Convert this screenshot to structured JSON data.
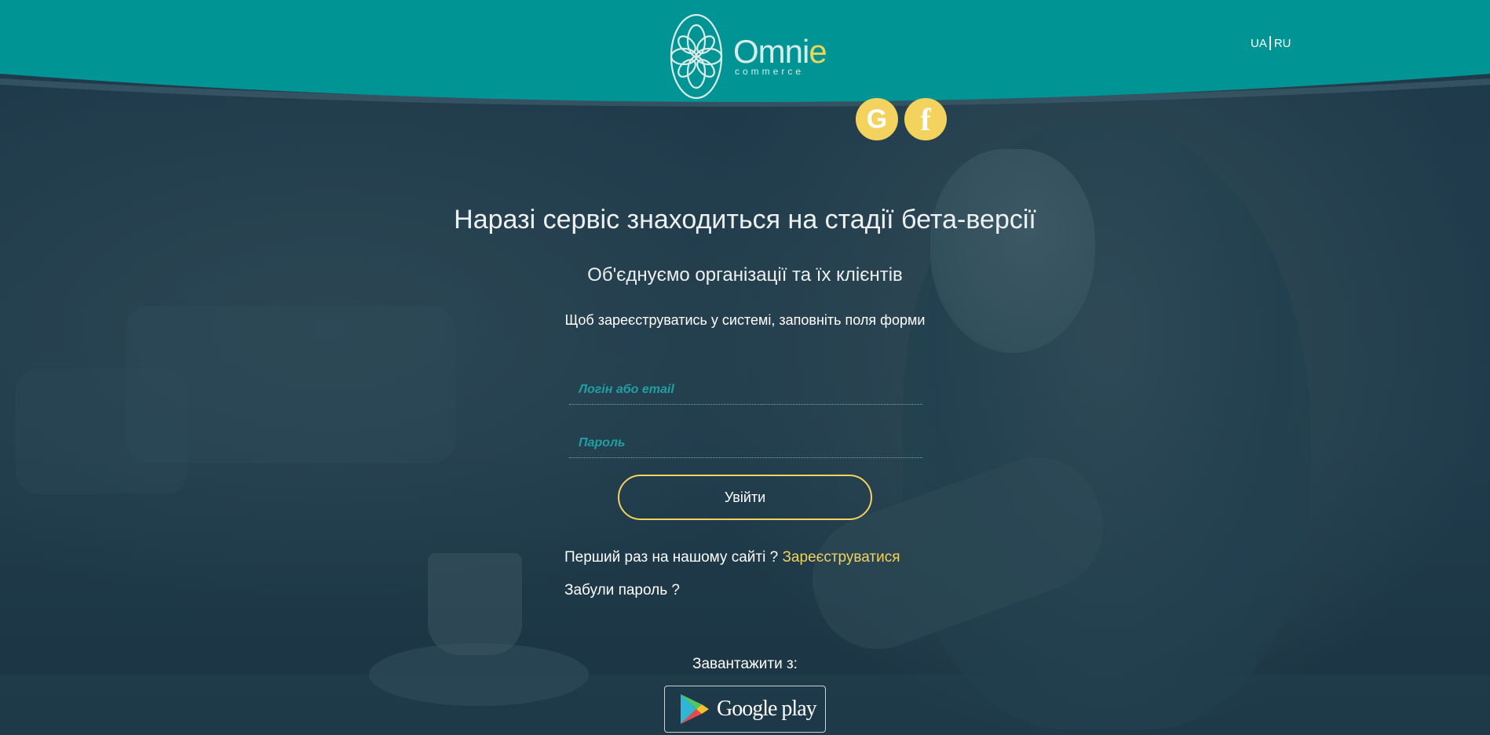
{
  "header": {
    "brand": "Omni",
    "brand_accent": "e",
    "brand_sub": "commerce",
    "lang": [
      "UA",
      "RU"
    ],
    "colors": {
      "teal": "#009494",
      "accent": "#f3d25e",
      "background": "#1d3848"
    }
  },
  "social": {
    "google": {
      "icon": "google-icon",
      "glyph": "G"
    },
    "facebook": {
      "icon": "facebook-icon",
      "glyph": "f"
    }
  },
  "main": {
    "title": "Наразі сервіс знаходиться на стадії бета-версії",
    "subtitle": "Об'єднуємо організації та їх клієнтів",
    "hint": "Щоб зареєструватись у системі, заповніть поля форми"
  },
  "form": {
    "login_placeholder": "Логін або email",
    "login_value": "",
    "password_placeholder": "Пароль",
    "password_value": "",
    "submit_label": "Увійти",
    "first_time_text": "Перший раз на нашому сайті ?",
    "register_link": "Зареєструватися",
    "forgot_text": "Забули пароль ?"
  },
  "download": {
    "label": "Завантажити з:",
    "store_label": "Google play",
    "store_icon": "google-play-icon"
  }
}
